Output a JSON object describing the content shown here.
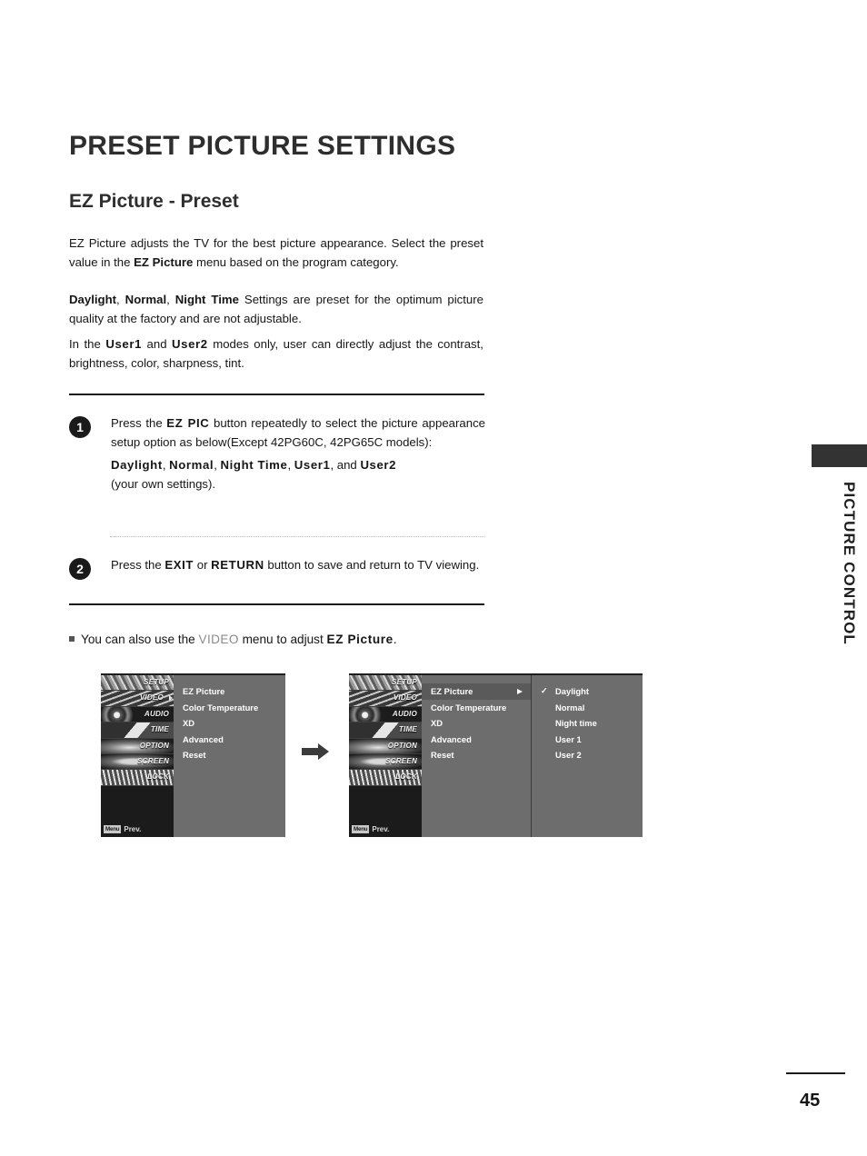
{
  "page": {
    "title": "PRESET PICTURE SETTINGS",
    "section_title": "EZ Picture - Preset",
    "number": "45",
    "side_tab_label": "PICTURE CONTROL"
  },
  "intro": {
    "p1_a": "EZ Picture adjusts the TV for the best picture appearance. Select the preset value in the ",
    "p1_b": "EZ Picture",
    "p1_c": " menu based on the program category.",
    "p2_a": "Daylight",
    "p2_sep1": ", ",
    "p2_b": "Normal",
    "p2_sep2": ", ",
    "p2_c": "Night Time",
    "p2_d": " Settings are preset for the optimum picture quality at the factory and are not adjustable.",
    "p3_a": "In the ",
    "p3_b": "User1",
    "p3_c": " and ",
    "p3_d": "User2",
    "p3_e": " modes only, user can directly adjust the contrast, brightness, color, sharpness, tint."
  },
  "steps": [
    {
      "number": "1",
      "t1": "Press the ",
      "key": "EZ PIC",
      "t2": " button repeatedly to select the picture appearance setup option as below(Except 42PG60C, 42PG65C models):",
      "opt1": "Daylight",
      "opt_sep1": ", ",
      "opt2": "Normal",
      "opt_sep2": ", ",
      "opt3": "Night Time",
      "opt_sep3": ", ",
      "opt4": "User1",
      "opt_sep4": ", and ",
      "opt5": "User2",
      "tail": "(your own settings)."
    },
    {
      "number": "2",
      "t1": "Press the ",
      "key1": "EXIT",
      "t2": " or ",
      "key2": "RETURN",
      "t3": " button to save and return to TV viewing."
    }
  ],
  "note": {
    "lead": "You can also use the ",
    "menu_name": "VIDEO",
    "mid": " menu to adjust ",
    "target": "EZ Picture",
    "tail": "."
  },
  "osd": {
    "sidebar": [
      {
        "label": "SETUP",
        "icon": "film-strip-icon",
        "has_arrow": false
      },
      {
        "label": "VIDEO",
        "icon": "color-bars-icon",
        "has_arrow": true
      },
      {
        "label": "AUDIO",
        "icon": "speaker-icon",
        "has_arrow": false
      },
      {
        "label": "TIME",
        "icon": "clock-icon",
        "has_arrow": false
      },
      {
        "label": "OPTION",
        "icon": "options-icon",
        "has_arrow": false
      },
      {
        "label": "SCREEN",
        "icon": "monitor-icon",
        "has_arrow": false
      },
      {
        "label": "LOCK",
        "icon": "lock-icon",
        "has_arrow": false
      }
    ],
    "prev_badge": "Menu",
    "prev_text": "Prev.",
    "menu_items": [
      "EZ Picture",
      "Color Temperature",
      "XD",
      "Advanced",
      "Reset"
    ],
    "selected_item": "EZ Picture",
    "submenu_items": [
      "Daylight",
      "Normal",
      "Night time",
      "User 1",
      "User 2"
    ],
    "submenu_checked": "Daylight",
    "check_glyph": "✓",
    "flow_arrow": "right-arrow-icon"
  },
  "colors": {
    "osd_panel": "#6d6d6d",
    "osd_sidebar": "#1b1b1b",
    "osd_selected": "#5a5a5a",
    "text": "#161616",
    "title": "#2e2e2e",
    "gray_caps": "#8a8a8a"
  }
}
